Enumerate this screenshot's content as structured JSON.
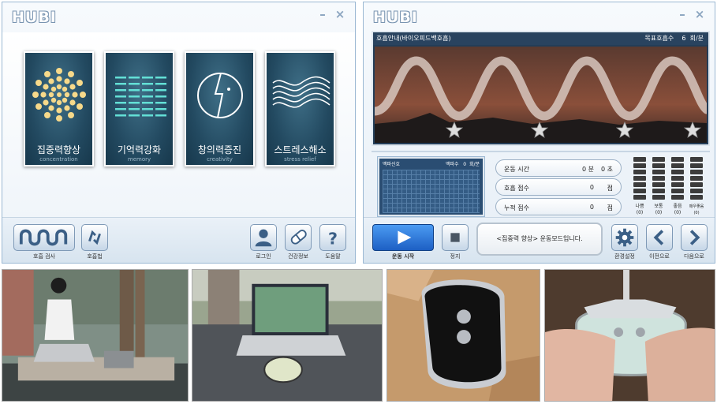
{
  "left_window": {
    "logo": "HUBI",
    "controls": {
      "minimize": "–",
      "close": "×"
    },
    "tiles": [
      {
        "title": "집중력향상",
        "subtitle": "concentration",
        "icon": "dots-sunburst-icon"
      },
      {
        "title": "기억력강화",
        "subtitle": "memory",
        "icon": "bars-grid-icon"
      },
      {
        "title": "창의력증진",
        "subtitle": "creativity",
        "icon": "face-circle-icon"
      },
      {
        "title": "스트레스해소",
        "subtitle": "stress relief",
        "icon": "wave-lines-icon"
      }
    ],
    "bottom": {
      "breath_test": "호흡 검사",
      "breath_method": "호흡법",
      "login": "로그인",
      "health_info": "건강정보",
      "help": "도움말"
    }
  },
  "right_window": {
    "logo": "HUBI",
    "controls": {
      "minimize": "–",
      "close": "×"
    },
    "guide": {
      "title": "호흡안내(바이오피드백호흡)",
      "goal_label": "목표호흡수",
      "goal_value": "6",
      "goal_unit": "회/분"
    },
    "pulse": {
      "title": "맥파신호",
      "label": "맥파수",
      "value": "0",
      "unit": "회/분"
    },
    "stats": [
      {
        "label": "운동 시간",
        "value": "0 분",
        "unit": "0 초"
      },
      {
        "label": "호흡 점수",
        "value": "0",
        "unit": "점"
      },
      {
        "label": "누적 점수",
        "value": "0",
        "unit": "점"
      }
    ],
    "meters": [
      {
        "label": "나쁨",
        "count": "(0)"
      },
      {
        "label": "보통",
        "count": "(0)"
      },
      {
        "label": "좋음",
        "count": "(0)"
      },
      {
        "label": "매우좋음",
        "count": "(0)"
      }
    ],
    "bottom": {
      "start": "운동 시작",
      "stop": "정지",
      "message": "<집중력 향상> 운동모드입니다.",
      "settings": "환경설정",
      "prev": "이전으로",
      "next": "다음으로"
    }
  },
  "photos": [
    {
      "name": "woman-using-device-photo"
    },
    {
      "name": "laptop-with-device-photo"
    },
    {
      "name": "device-closeup-photo"
    },
    {
      "name": "hands-holding-device-photo"
    }
  ]
}
